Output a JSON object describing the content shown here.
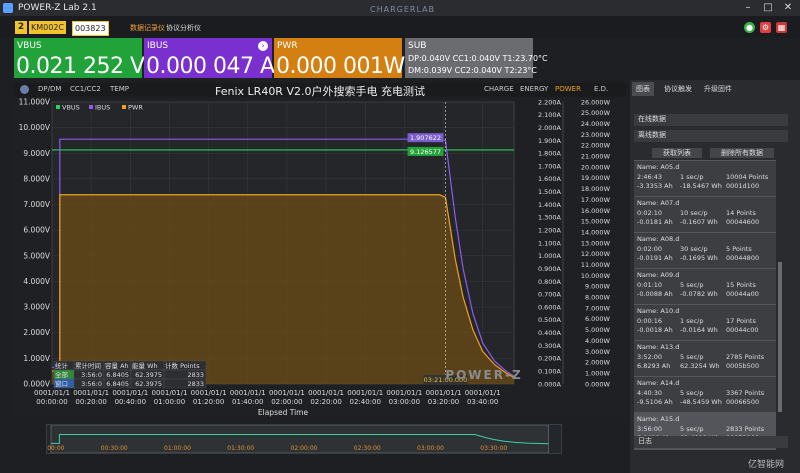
{
  "window": {
    "title": "POWER-Z Lab 2.1",
    "brand": "CHARGERLAB"
  },
  "device": {
    "index": "2",
    "model": "KM002C",
    "serial": "003823"
  },
  "nav": {
    "data_logger": "数据记录仪",
    "protocol_analyzer": "协议分析仪"
  },
  "metrics": {
    "vbus": {
      "label": "VBUS",
      "value": "0.021 252 V",
      "color": "#22a33a"
    },
    "ibus": {
      "label": "IBUS",
      "value": "0.000 047 A",
      "color": "#7a2fcf"
    },
    "pwr": {
      "label": "PWR",
      "value": "0.000 001W",
      "color": "#d37f12"
    }
  },
  "sub": {
    "label": "SUB",
    "line1": "DP:0.040V  CC1:0.040V  T1:23.70°C",
    "line2": "DM:0.039V  CC2:0.040V  T2:23°C"
  },
  "chart_toolbar": {
    "left_tabs": [
      "DP/DM",
      "CC1/CC2",
      "TEMP"
    ],
    "right_tabs": [
      "CHARGE",
      "ENERGY",
      "POWER",
      "E.D."
    ],
    "active_right": "POWER",
    "title": "Fenix LR40R V2.0户外搜索手电   充电测试"
  },
  "chart_data": {
    "type": "line",
    "legend": [
      "VBUS",
      "IBUS",
      "PWR"
    ],
    "colors": {
      "VBUS": "#2fcf5a",
      "IBUS": "#8a5cf0",
      "PWR": "#f0a020"
    },
    "y_left": {
      "min": 0,
      "max": 11,
      "ticks": [
        "0.000V",
        "1.000V",
        "2.000V",
        "3.000V",
        "4.000V",
        "5.000V",
        "6.000V",
        "7.000V",
        "8.000V",
        "9.000V",
        "10.000V",
        "11.000V"
      ]
    },
    "y_mid": {
      "min": 0,
      "max": 2.2,
      "ticks": [
        "0.000A",
        "0.100A",
        "0.200A",
        "0.300A",
        "0.400A",
        "0.500A",
        "0.600A",
        "0.700A",
        "0.800A",
        "0.900A",
        "1.000A",
        "1.100A",
        "1.200A",
        "1.300A",
        "1.400A",
        "1.500A",
        "1.600A",
        "1.700A",
        "1.800A",
        "1.900A",
        "2.000A",
        "2.100A",
        "2.200A"
      ]
    },
    "y_right": {
      "min": 0,
      "max": 26,
      "ticks": [
        "0.000W",
        "1.000W",
        "2.000W",
        "3.000W",
        "4.000W",
        "5.000W",
        "6.000W",
        "7.000W",
        "8.000W",
        "9.000W",
        "10.000W",
        "11.000W",
        "12.000W",
        "13.000W",
        "14.000W",
        "15.000W",
        "16.000W",
        "17.000W",
        "18.000W",
        "19.000W",
        "20.000W",
        "21.000W",
        "22.000W",
        "23.000W",
        "24.000W",
        "25.000W",
        "26.000W"
      ]
    },
    "x_ticks": [
      [
        "0001/01/1",
        "00:00:00"
      ],
      [
        "0001/01/1",
        "00:20:00"
      ],
      [
        "0001/01/1",
        "00:40:00"
      ],
      [
        "0001/01/1",
        "01:00:00"
      ],
      [
        "0001/01/1",
        "01:20:00"
      ],
      [
        "0001/01/1",
        "01:40:00"
      ],
      [
        "0001/01/1",
        "02:00:00"
      ],
      [
        "0001/01/1",
        "02:20:00"
      ],
      [
        "0001/01/1",
        "02:40:00"
      ],
      [
        "0001/01/1",
        "03:00:00"
      ],
      [
        "0001/01/1",
        "03:20:00"
      ],
      [
        "0001/01/1",
        "03:40:00"
      ]
    ],
    "x_minutes_max": 236,
    "x_label": "Elapsed Time",
    "series": [
      {
        "name": "VBUS",
        "x": [
          0,
          4,
          4,
          200,
          203,
          206,
          236
        ],
        "y": [
          9.13,
          9.13,
          9.13,
          9.13,
          9.13,
          9.13,
          9.13
        ]
      },
      {
        "name": "IBUS",
        "x": [
          0,
          4,
          4,
          198,
          201,
          206,
          210,
          215,
          220,
          226,
          232,
          236
        ],
        "y": [
          0.13,
          0.13,
          1.91,
          1.91,
          1.9,
          1.3,
          0.9,
          0.55,
          0.32,
          0.18,
          0.1,
          0.06
        ]
      },
      {
        "name": "PWR",
        "x": [
          0,
          4,
          4,
          198,
          201,
          206,
          210,
          215,
          220,
          226,
          232,
          236
        ],
        "y": [
          1.2,
          1.2,
          17.45,
          17.45,
          17.2,
          11.5,
          8.0,
          5.0,
          3.0,
          1.8,
          1.0,
          0.6
        ]
      }
    ],
    "cursor": {
      "x_minutes": 201,
      "label": "03:21:00.000",
      "ibus_label": "1.907622",
      "vbus_label": "9.126577"
    },
    "stats_table": {
      "headers": [
        "统计",
        "累计时间",
        "容量 Ah",
        "能量 Wh",
        "计数 Points"
      ],
      "rows": [
        [
          "全部",
          "3:56:0",
          "6.8405",
          "62.3975",
          "2833"
        ],
        [
          "窗口",
          "3:56:0",
          "6.8405",
          "62.3975",
          "2833"
        ]
      ]
    },
    "chart_watermark": "POWER-Z",
    "timeline_ticks": [
      "00:00:00",
      "00:30:00",
      "01:00:00",
      "01:30:00",
      "02:00:00",
      "02:30:00",
      "03:00:00",
      "03:30:00"
    ]
  },
  "right_panel": {
    "tabs": [
      "图表",
      "协议触发",
      "升级固件"
    ],
    "online_data": "在线数据",
    "offline_data": "离线数据",
    "get_list": "获取列表",
    "delete_all": "删除所有数据",
    "records": [
      {
        "name": "Name: A05.d",
        "l2a": "2:46:43",
        "l2b": "1 sec/p",
        "l2c": "10004 Points",
        "l3a": "-3.3353 Ah",
        "l3b": "-18.5467 Wh",
        "l3c": "0001d100"
      },
      {
        "name": "Name: A07.d",
        "l2a": "0:02:10",
        "l2b": "10 sec/p",
        "l2c": "14 Points",
        "l3a": "-0.0181 Ah",
        "l3b": "-0.1607 Wh",
        "l3c": "00044600"
      },
      {
        "name": "Name: A08.d",
        "l2a": "0:02:00",
        "l2b": "30 sec/p",
        "l2c": "5 Points",
        "l3a": "-0.0191 Ah",
        "l3b": "-0.1695 Wh",
        "l3c": "00044800"
      },
      {
        "name": "Name: A09.d",
        "l2a": "0:01:10",
        "l2b": "5 sec/p",
        "l2c": "15 Points",
        "l3a": "-0.0088 Ah",
        "l3b": "-0.0782 Wh",
        "l3c": "00044a00"
      },
      {
        "name": "Name: A10.d",
        "l2a": "0:00:16",
        "l2b": "1 sec/p",
        "l2c": "17 Points",
        "l3a": "-0.0018 Ah",
        "l3b": "-0.0164 Wh",
        "l3c": "00044c00"
      },
      {
        "name": "Name: A13.d",
        "l2a": "3:52:00",
        "l2b": "5 sec/p",
        "l2c": "2785 Points",
        "l3a": "6.8293 Ah",
        "l3b": "62.3254 Wh",
        "l3c": "0005b500"
      },
      {
        "name": "Name: A14.d",
        "l2a": "4:40:30",
        "l2b": "5 sec/p",
        "l2c": "3367 Points",
        "l3a": "-9.5106 Ah",
        "l3b": "-48.5459 Wh",
        "l3c": "00066500"
      },
      {
        "name": "Name: A15.d",
        "l2a": "3:56:00",
        "l2b": "5 sec/p",
        "l2c": "2833 Points",
        "l3a": "6.8410 Ah",
        "l3b": "62.4018 Wh",
        "l3c": "00073900"
      }
    ],
    "log_label": "日志"
  },
  "watermark": "亿智能网"
}
